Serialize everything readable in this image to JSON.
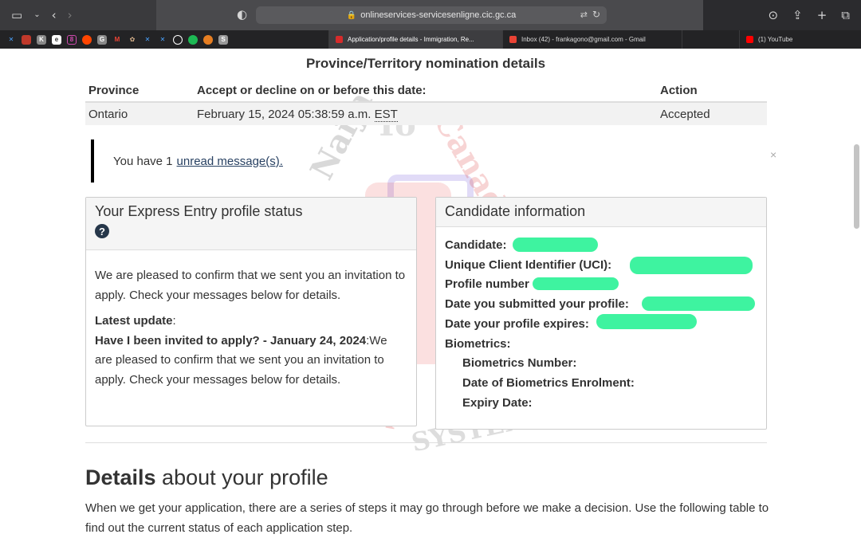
{
  "browser": {
    "url": "onlineservices-servicesenligne.cic.gc.ca",
    "tabs": [
      {
        "title": "Application/profile details - Immigration, Re...",
        "active": true
      },
      {
        "title": "Inbox (42) - frankagono@gmail.com - Gmail",
        "active": false
      },
      {
        "title": "(1) YouTube",
        "active": false
      }
    ],
    "pinned_icons": [
      "x",
      "app",
      "K",
      "er",
      "8",
      "reddit",
      "G",
      "M",
      "app",
      "x",
      "x",
      "app",
      "app",
      "app",
      "S"
    ]
  },
  "nomination": {
    "title": "Province/Territory nomination details",
    "headers": [
      "Province",
      "Accept or decline on or before this date:",
      "Action"
    ],
    "row": {
      "province": "Ontario",
      "date": "February 15, 2024 05:38:59 a.m.",
      "tz": "EST",
      "action": "Accepted"
    }
  },
  "alert": {
    "text": "You have 1",
    "link": "unread message(s)."
  },
  "profile_status": {
    "title": "Your Express Entry profile status",
    "help_glyph": "?",
    "message": "We are pleased to confirm that we sent you an invitation to apply. Check your messages below for details.",
    "latest_label": "Latest update",
    "latest_colon": ":",
    "latest_bold": "Have I been invited to apply? - January 24, 2024",
    "latest_rest": ":We are pleased to confirm that we sent you an invitation to apply. Check your messages below for details."
  },
  "candidate": {
    "title": "Candidate information",
    "fields": [
      "Candidate:",
      "Unique Client Identifier (UCI):",
      "Profile number",
      "Date you submitted your profile:",
      "Date your profile expires:",
      "Biometrics:"
    ],
    "biometrics_fields": [
      "Biometrics Number:",
      "Date of Biometrics Enrolment:",
      "Expiry Date:"
    ]
  },
  "details": {
    "title_bold": "Details",
    "title_rest": " about your profile",
    "body": "When we get your application, there are a series of steps it may go through before we make a decision. Use the following table to find out the current status of each application step."
  },
  "watermark": {
    "line1": "Naija",
    "line2": "To",
    "line3": "Canada",
    "line4": "JAPA",
    "line5": "SYSTEM"
  },
  "colors": {
    "redaction": "#3ef3a0",
    "link": "#284162",
    "help_icon": "#26374a"
  }
}
